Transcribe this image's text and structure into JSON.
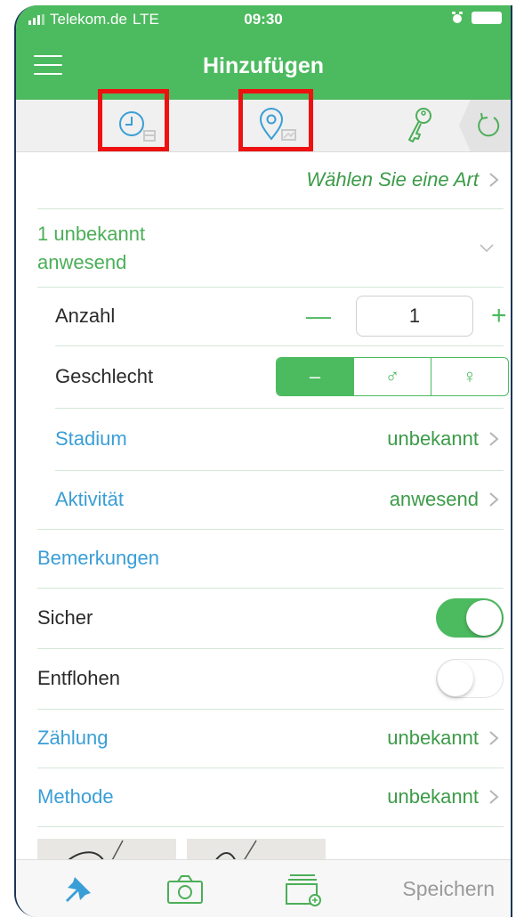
{
  "status": {
    "carrier": "Telekom.de",
    "network": "LTE",
    "time": "09:30"
  },
  "nav": {
    "title": "Hinzufügen",
    "menu_icon": "hamburger-icon"
  },
  "toolbar": {
    "items": [
      "clock-icon",
      "map-pin-icon",
      "key-icon",
      "undo-icon"
    ]
  },
  "form": {
    "species": {
      "value": "Wählen Sie eine Art"
    },
    "summary": {
      "line1": "1 unbekannt",
      "line2": "anwesend"
    },
    "count": {
      "label": "Anzahl",
      "value": "1",
      "minus": "—",
      "plus": "+"
    },
    "sex": {
      "label": "Geschlecht",
      "options": [
        "–",
        "♂",
        "♀"
      ]
    },
    "stage": {
      "label": "Stadium",
      "value": "unbekannt"
    },
    "activity": {
      "label": "Aktivität",
      "value": "anwesend"
    },
    "remarks": {
      "label": "Bemerkungen"
    },
    "certain": {
      "label": "Sicher",
      "on": true
    },
    "escaped": {
      "label": "Entflohen",
      "on": false
    },
    "counting": {
      "label": "Zählung",
      "value": "unbekannt"
    },
    "method": {
      "label": "Methode",
      "value": "unbekannt"
    }
  },
  "tabbar": {
    "save_label": "Speichern"
  },
  "colors": {
    "accent": "#4cba5f",
    "blue": "#3a9ed6",
    "highlight": "#ee1111"
  }
}
